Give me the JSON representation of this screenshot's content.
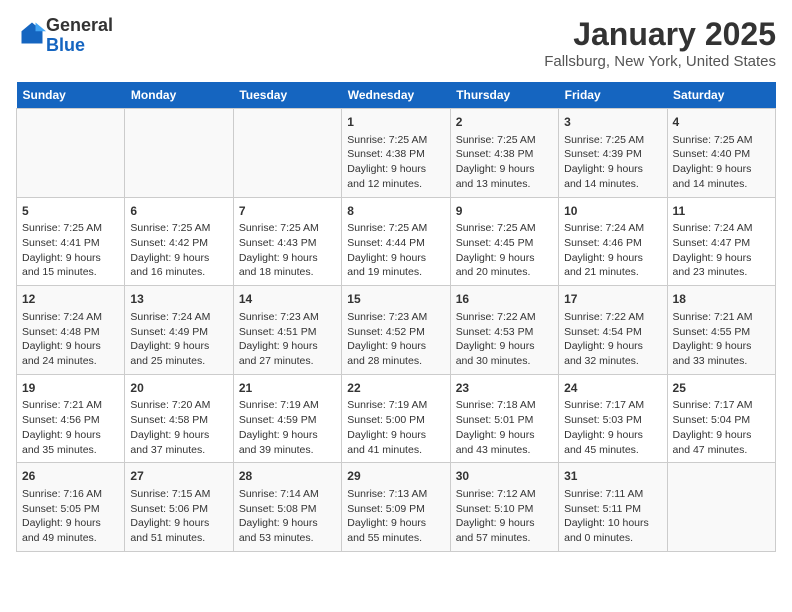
{
  "logo": {
    "general": "General",
    "blue": "Blue"
  },
  "header": {
    "title": "January 2025",
    "subtitle": "Fallsburg, New York, United States"
  },
  "weekdays": [
    "Sunday",
    "Monday",
    "Tuesday",
    "Wednesday",
    "Thursday",
    "Friday",
    "Saturday"
  ],
  "weeks": [
    [
      {
        "day": "",
        "content": ""
      },
      {
        "day": "",
        "content": ""
      },
      {
        "day": "",
        "content": ""
      },
      {
        "day": "1",
        "content": "Sunrise: 7:25 AM\nSunset: 4:38 PM\nDaylight: 9 hours and 12 minutes."
      },
      {
        "day": "2",
        "content": "Sunrise: 7:25 AM\nSunset: 4:38 PM\nDaylight: 9 hours and 13 minutes."
      },
      {
        "day": "3",
        "content": "Sunrise: 7:25 AM\nSunset: 4:39 PM\nDaylight: 9 hours and 14 minutes."
      },
      {
        "day": "4",
        "content": "Sunrise: 7:25 AM\nSunset: 4:40 PM\nDaylight: 9 hours and 14 minutes."
      }
    ],
    [
      {
        "day": "5",
        "content": "Sunrise: 7:25 AM\nSunset: 4:41 PM\nDaylight: 9 hours and 15 minutes."
      },
      {
        "day": "6",
        "content": "Sunrise: 7:25 AM\nSunset: 4:42 PM\nDaylight: 9 hours and 16 minutes."
      },
      {
        "day": "7",
        "content": "Sunrise: 7:25 AM\nSunset: 4:43 PM\nDaylight: 9 hours and 18 minutes."
      },
      {
        "day": "8",
        "content": "Sunrise: 7:25 AM\nSunset: 4:44 PM\nDaylight: 9 hours and 19 minutes."
      },
      {
        "day": "9",
        "content": "Sunrise: 7:25 AM\nSunset: 4:45 PM\nDaylight: 9 hours and 20 minutes."
      },
      {
        "day": "10",
        "content": "Sunrise: 7:24 AM\nSunset: 4:46 PM\nDaylight: 9 hours and 21 minutes."
      },
      {
        "day": "11",
        "content": "Sunrise: 7:24 AM\nSunset: 4:47 PM\nDaylight: 9 hours and 23 minutes."
      }
    ],
    [
      {
        "day": "12",
        "content": "Sunrise: 7:24 AM\nSunset: 4:48 PM\nDaylight: 9 hours and 24 minutes."
      },
      {
        "day": "13",
        "content": "Sunrise: 7:24 AM\nSunset: 4:49 PM\nDaylight: 9 hours and 25 minutes."
      },
      {
        "day": "14",
        "content": "Sunrise: 7:23 AM\nSunset: 4:51 PM\nDaylight: 9 hours and 27 minutes."
      },
      {
        "day": "15",
        "content": "Sunrise: 7:23 AM\nSunset: 4:52 PM\nDaylight: 9 hours and 28 minutes."
      },
      {
        "day": "16",
        "content": "Sunrise: 7:22 AM\nSunset: 4:53 PM\nDaylight: 9 hours and 30 minutes."
      },
      {
        "day": "17",
        "content": "Sunrise: 7:22 AM\nSunset: 4:54 PM\nDaylight: 9 hours and 32 minutes."
      },
      {
        "day": "18",
        "content": "Sunrise: 7:21 AM\nSunset: 4:55 PM\nDaylight: 9 hours and 33 minutes."
      }
    ],
    [
      {
        "day": "19",
        "content": "Sunrise: 7:21 AM\nSunset: 4:56 PM\nDaylight: 9 hours and 35 minutes."
      },
      {
        "day": "20",
        "content": "Sunrise: 7:20 AM\nSunset: 4:58 PM\nDaylight: 9 hours and 37 minutes."
      },
      {
        "day": "21",
        "content": "Sunrise: 7:19 AM\nSunset: 4:59 PM\nDaylight: 9 hours and 39 minutes."
      },
      {
        "day": "22",
        "content": "Sunrise: 7:19 AM\nSunset: 5:00 PM\nDaylight: 9 hours and 41 minutes."
      },
      {
        "day": "23",
        "content": "Sunrise: 7:18 AM\nSunset: 5:01 PM\nDaylight: 9 hours and 43 minutes."
      },
      {
        "day": "24",
        "content": "Sunrise: 7:17 AM\nSunset: 5:03 PM\nDaylight: 9 hours and 45 minutes."
      },
      {
        "day": "25",
        "content": "Sunrise: 7:17 AM\nSunset: 5:04 PM\nDaylight: 9 hours and 47 minutes."
      }
    ],
    [
      {
        "day": "26",
        "content": "Sunrise: 7:16 AM\nSunset: 5:05 PM\nDaylight: 9 hours and 49 minutes."
      },
      {
        "day": "27",
        "content": "Sunrise: 7:15 AM\nSunset: 5:06 PM\nDaylight: 9 hours and 51 minutes."
      },
      {
        "day": "28",
        "content": "Sunrise: 7:14 AM\nSunset: 5:08 PM\nDaylight: 9 hours and 53 minutes."
      },
      {
        "day": "29",
        "content": "Sunrise: 7:13 AM\nSunset: 5:09 PM\nDaylight: 9 hours and 55 minutes."
      },
      {
        "day": "30",
        "content": "Sunrise: 7:12 AM\nSunset: 5:10 PM\nDaylight: 9 hours and 57 minutes."
      },
      {
        "day": "31",
        "content": "Sunrise: 7:11 AM\nSunset: 5:11 PM\nDaylight: 10 hours and 0 minutes."
      },
      {
        "day": "",
        "content": ""
      }
    ]
  ]
}
